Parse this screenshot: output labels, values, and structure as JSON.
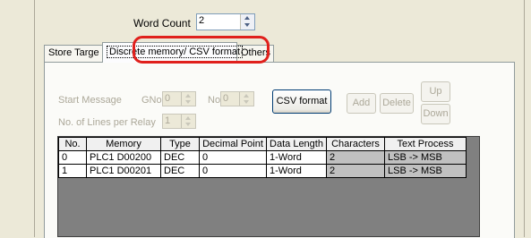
{
  "word_count": {
    "label": "Word Count",
    "value": "2"
  },
  "tabs": [
    {
      "label": "Store Targe"
    },
    {
      "label": "Discrete memory/ CSV format"
    },
    {
      "label": "Others"
    }
  ],
  "settings": {
    "start_message_label": "Start Message",
    "gno_label": "GNo",
    "gno_value": "0",
    "no_label": "No",
    "no_value": "0",
    "lines_per_relay_label": "No. of Lines per Relay",
    "lines_per_relay_value": "1"
  },
  "buttons": {
    "csv_format": "CSV format",
    "add": "Add",
    "delete": "Delete",
    "up": "Up",
    "down": "Down"
  },
  "table": {
    "columns": [
      "No.",
      "Memory",
      "Type",
      "Decimal Point",
      "Data Length",
      "Characters",
      "Text Process"
    ],
    "rows": [
      [
        "0",
        "PLC1 D00200",
        "DEC",
        "0",
        "1-Word",
        "2",
        "LSB -> MSB"
      ],
      [
        "1",
        "PLC1 D00201",
        "DEC",
        "0",
        "1-Word",
        "2",
        "LSB -> MSB"
      ]
    ]
  },
  "colors": {
    "highlight": "#e0201c",
    "window_bg": "#ece9d8",
    "grid_bg": "#808080"
  }
}
